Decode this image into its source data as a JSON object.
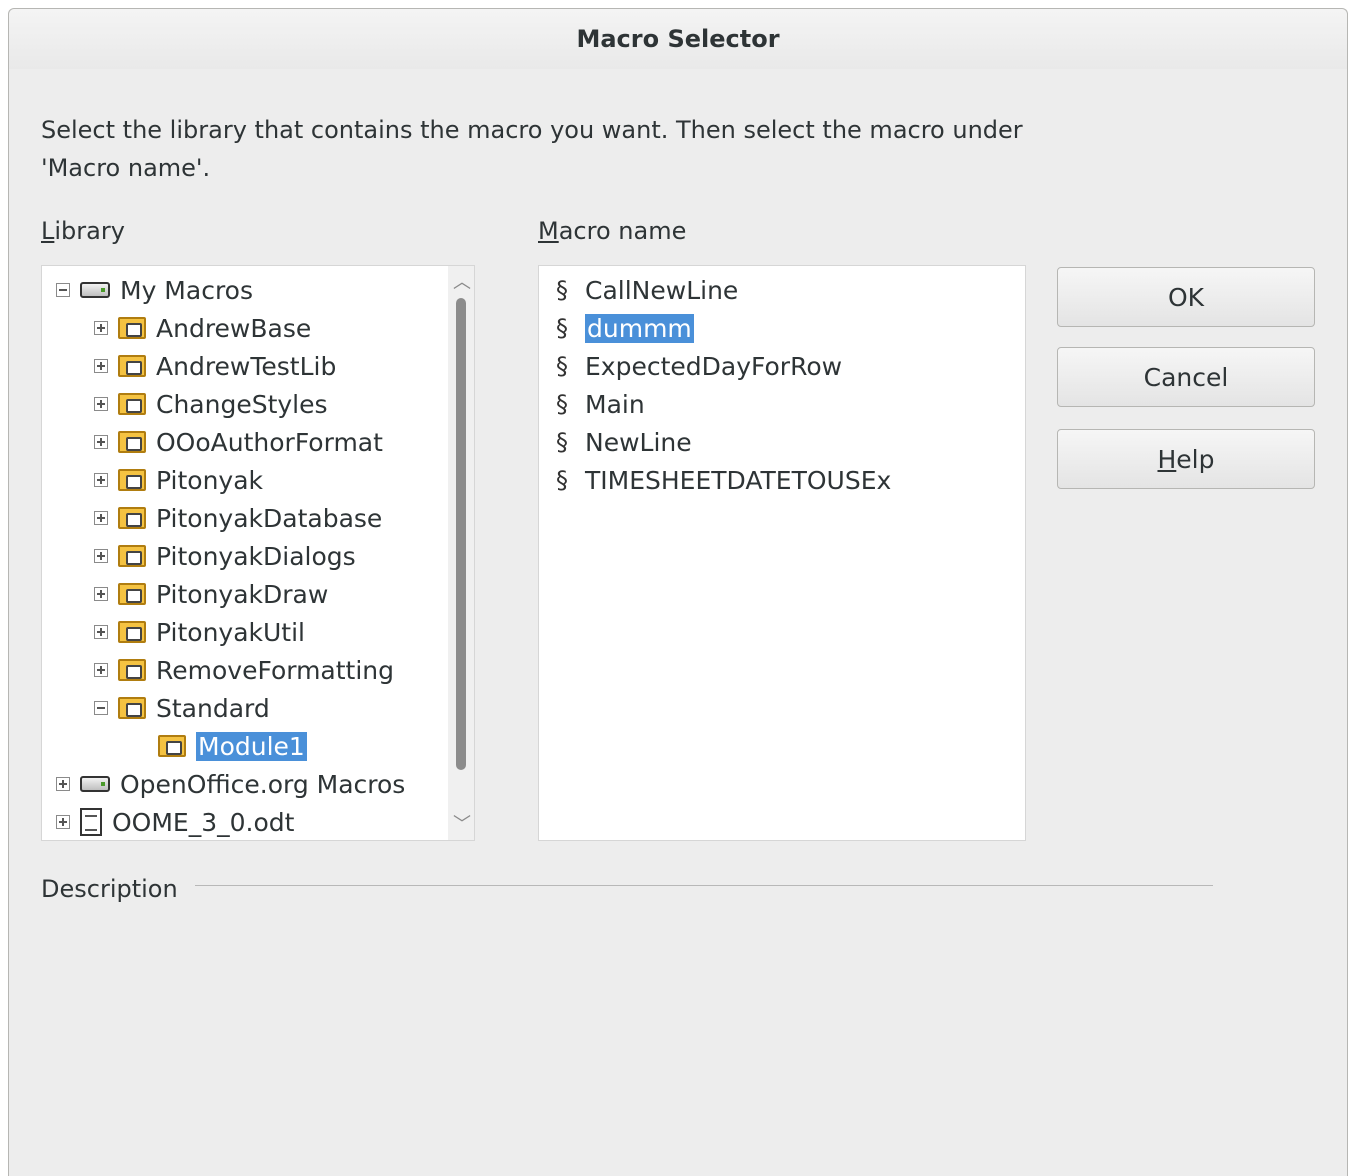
{
  "window": {
    "title": "Macro Selector"
  },
  "intro_text": "Select the library that contains the macro you want. Then select the macro under 'Macro name'.",
  "library": {
    "label_mnemonic": "L",
    "label_rest": "ibrary",
    "items": [
      {
        "label": "My Macros",
        "icon": "drive-icon",
        "expander": "minus"
      },
      {
        "label": "AndrewBase",
        "icon": "library-folder-icon",
        "expander": "plus"
      },
      {
        "label": "AndrewTestLib",
        "icon": "library-folder-icon",
        "expander": "plus"
      },
      {
        "label": "ChangeStyles",
        "icon": "library-folder-icon",
        "expander": "plus"
      },
      {
        "label": "OOoAuthorFormat",
        "icon": "library-folder-icon",
        "expander": "plus"
      },
      {
        "label": "Pitonyak",
        "icon": "library-folder-icon",
        "expander": "plus"
      },
      {
        "label": "PitonyakDatabase",
        "icon": "library-folder-icon",
        "expander": "plus"
      },
      {
        "label": "PitonyakDialogs",
        "icon": "library-folder-icon",
        "expander": "plus"
      },
      {
        "label": "PitonyakDraw",
        "icon": "library-folder-icon",
        "expander": "plus"
      },
      {
        "label": "PitonyakUtil",
        "icon": "library-folder-icon",
        "expander": "plus"
      },
      {
        "label": "RemoveFormatting",
        "icon": "library-folder-icon",
        "expander": "plus"
      },
      {
        "label": "Standard",
        "icon": "library-folder-icon",
        "expander": "minus"
      },
      {
        "label": "Module1",
        "icon": "module-icon",
        "selected": true
      },
      {
        "label": "OpenOffice.org Macros",
        "icon": "drive-icon",
        "expander": "plus"
      },
      {
        "label": "OOME_3_0.odt",
        "icon": "document-icon",
        "expander": "plus"
      }
    ]
  },
  "macro_name": {
    "label_mnemonic": "M",
    "label_rest": "acro name",
    "items": [
      {
        "label": "CallNewLine",
        "icon": "macro-script-icon"
      },
      {
        "label": "dummm",
        "icon": "macro-script-icon",
        "selected": true
      },
      {
        "label": "ExpectedDayForRow",
        "icon": "macro-script-icon"
      },
      {
        "label": "Main",
        "icon": "macro-script-icon"
      },
      {
        "label": "NewLine",
        "icon": "macro-script-icon"
      },
      {
        "label": "TIMESHEETDATETOUSEx",
        "icon": "macro-script-icon"
      }
    ]
  },
  "buttons": {
    "ok": "OK",
    "cancel": "Cancel",
    "help_mnemonic": "H",
    "help_rest": "elp"
  },
  "description_label": "Description",
  "colors": {
    "selection": "#4a90d9",
    "dialog_bg": "#ededed"
  }
}
